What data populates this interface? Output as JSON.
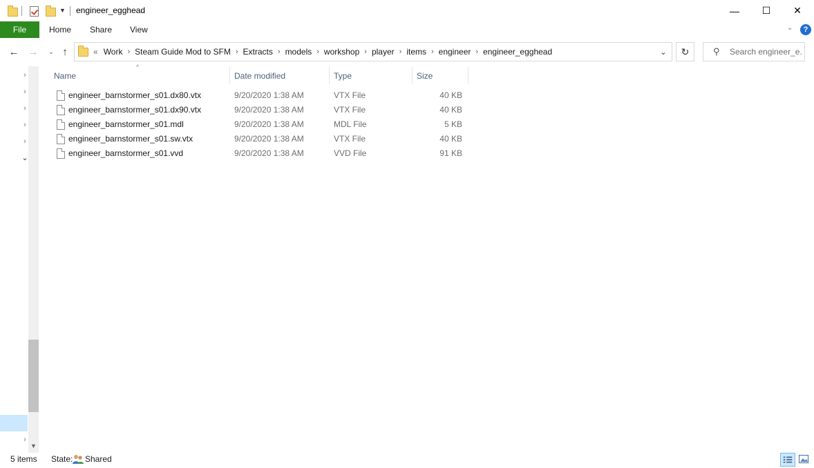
{
  "window": {
    "title": "engineer_egghead",
    "controls": {
      "minimize": "—",
      "maximize": "☐",
      "close": "✕"
    }
  },
  "ribbon": {
    "file": "File",
    "tabs": [
      "Home",
      "Share",
      "View"
    ],
    "help": "?"
  },
  "nav": {
    "address_prefix": "«",
    "breadcrumbs": [
      "Work",
      "Steam Guide Mod to SFM",
      "Extracts",
      "models",
      "workshop",
      "player",
      "items",
      "engineer",
      "engineer_egghead"
    ],
    "search_placeholder": "Search engineer_e..."
  },
  "columns": {
    "name": "Name",
    "date": "Date modified",
    "type": "Type",
    "size": "Size"
  },
  "files": [
    {
      "name": "engineer_barnstormer_s01.dx80.vtx",
      "date": "9/20/2020 1:38 AM",
      "type": "VTX File",
      "size": "40 KB"
    },
    {
      "name": "engineer_barnstormer_s01.dx90.vtx",
      "date": "9/20/2020 1:38 AM",
      "type": "VTX File",
      "size": "40 KB"
    },
    {
      "name": "engineer_barnstormer_s01.mdl",
      "date": "9/20/2020 1:38 AM",
      "type": "MDL File",
      "size": "5 KB"
    },
    {
      "name": "engineer_barnstormer_s01.sw.vtx",
      "date": "9/20/2020 1:38 AM",
      "type": "VTX File",
      "size": "40 KB"
    },
    {
      "name": "engineer_barnstormer_s01.vvd",
      "date": "9/20/2020 1:38 AM",
      "type": "VVD File",
      "size": "91 KB"
    }
  ],
  "status": {
    "count": "5 items",
    "state_label": "State:",
    "state_value": "Shared"
  },
  "colors": {
    "file_tab": "#2c8a1f",
    "selection": "#cce8ff",
    "help": "#1f6fd1",
    "header_text": "#4c607a"
  }
}
